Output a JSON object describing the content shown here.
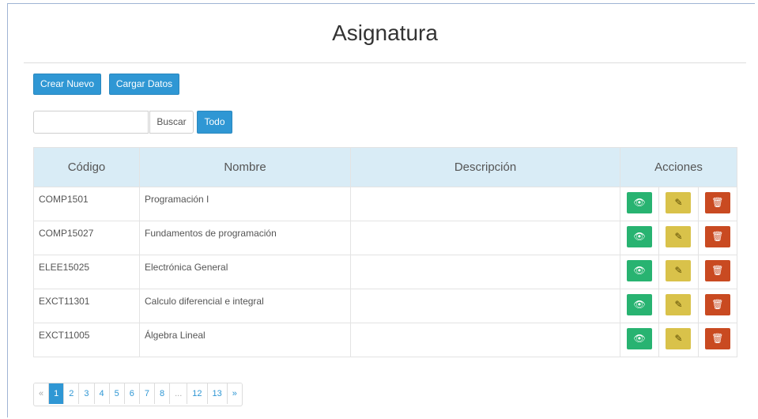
{
  "page": {
    "title": "Asignatura"
  },
  "toolbar": {
    "new_label": "Crear Nuevo",
    "load_label": "Cargar Datos"
  },
  "search": {
    "value": "",
    "placeholder": "",
    "search_label": "Buscar",
    "all_label": "Todo"
  },
  "table": {
    "columns": [
      "Código",
      "Nombre",
      "Descripción",
      "Acciones"
    ],
    "rows": [
      {
        "code": "COMP1501",
        "name": "Programación I",
        "description": ""
      },
      {
        "code": "COMP15027",
        "name": "Fundamentos de programación",
        "description": ""
      },
      {
        "code": "ELEE15025",
        "name": "Electrónica General",
        "description": ""
      },
      {
        "code": "EXCT11301",
        "name": "Calculo diferencial e integral",
        "description": ""
      },
      {
        "code": "EXCT11005",
        "name": "Álgebra Lineal",
        "description": ""
      }
    ],
    "actions": {
      "view_icon": "eye-icon",
      "edit_icon": "edit-icon",
      "delete_icon": "trash-icon"
    }
  },
  "pagination": {
    "prev": "«",
    "pages": [
      "1",
      "2",
      "3",
      "4",
      "5",
      "6",
      "7",
      "8",
      "...",
      "12",
      "13"
    ],
    "next": "»",
    "current": "1"
  },
  "colors": {
    "primary": "#2f97d4",
    "view": "#28b371",
    "edit": "#d9c24a",
    "delete": "#c94a21",
    "header_bg": "#d9ecf6"
  }
}
